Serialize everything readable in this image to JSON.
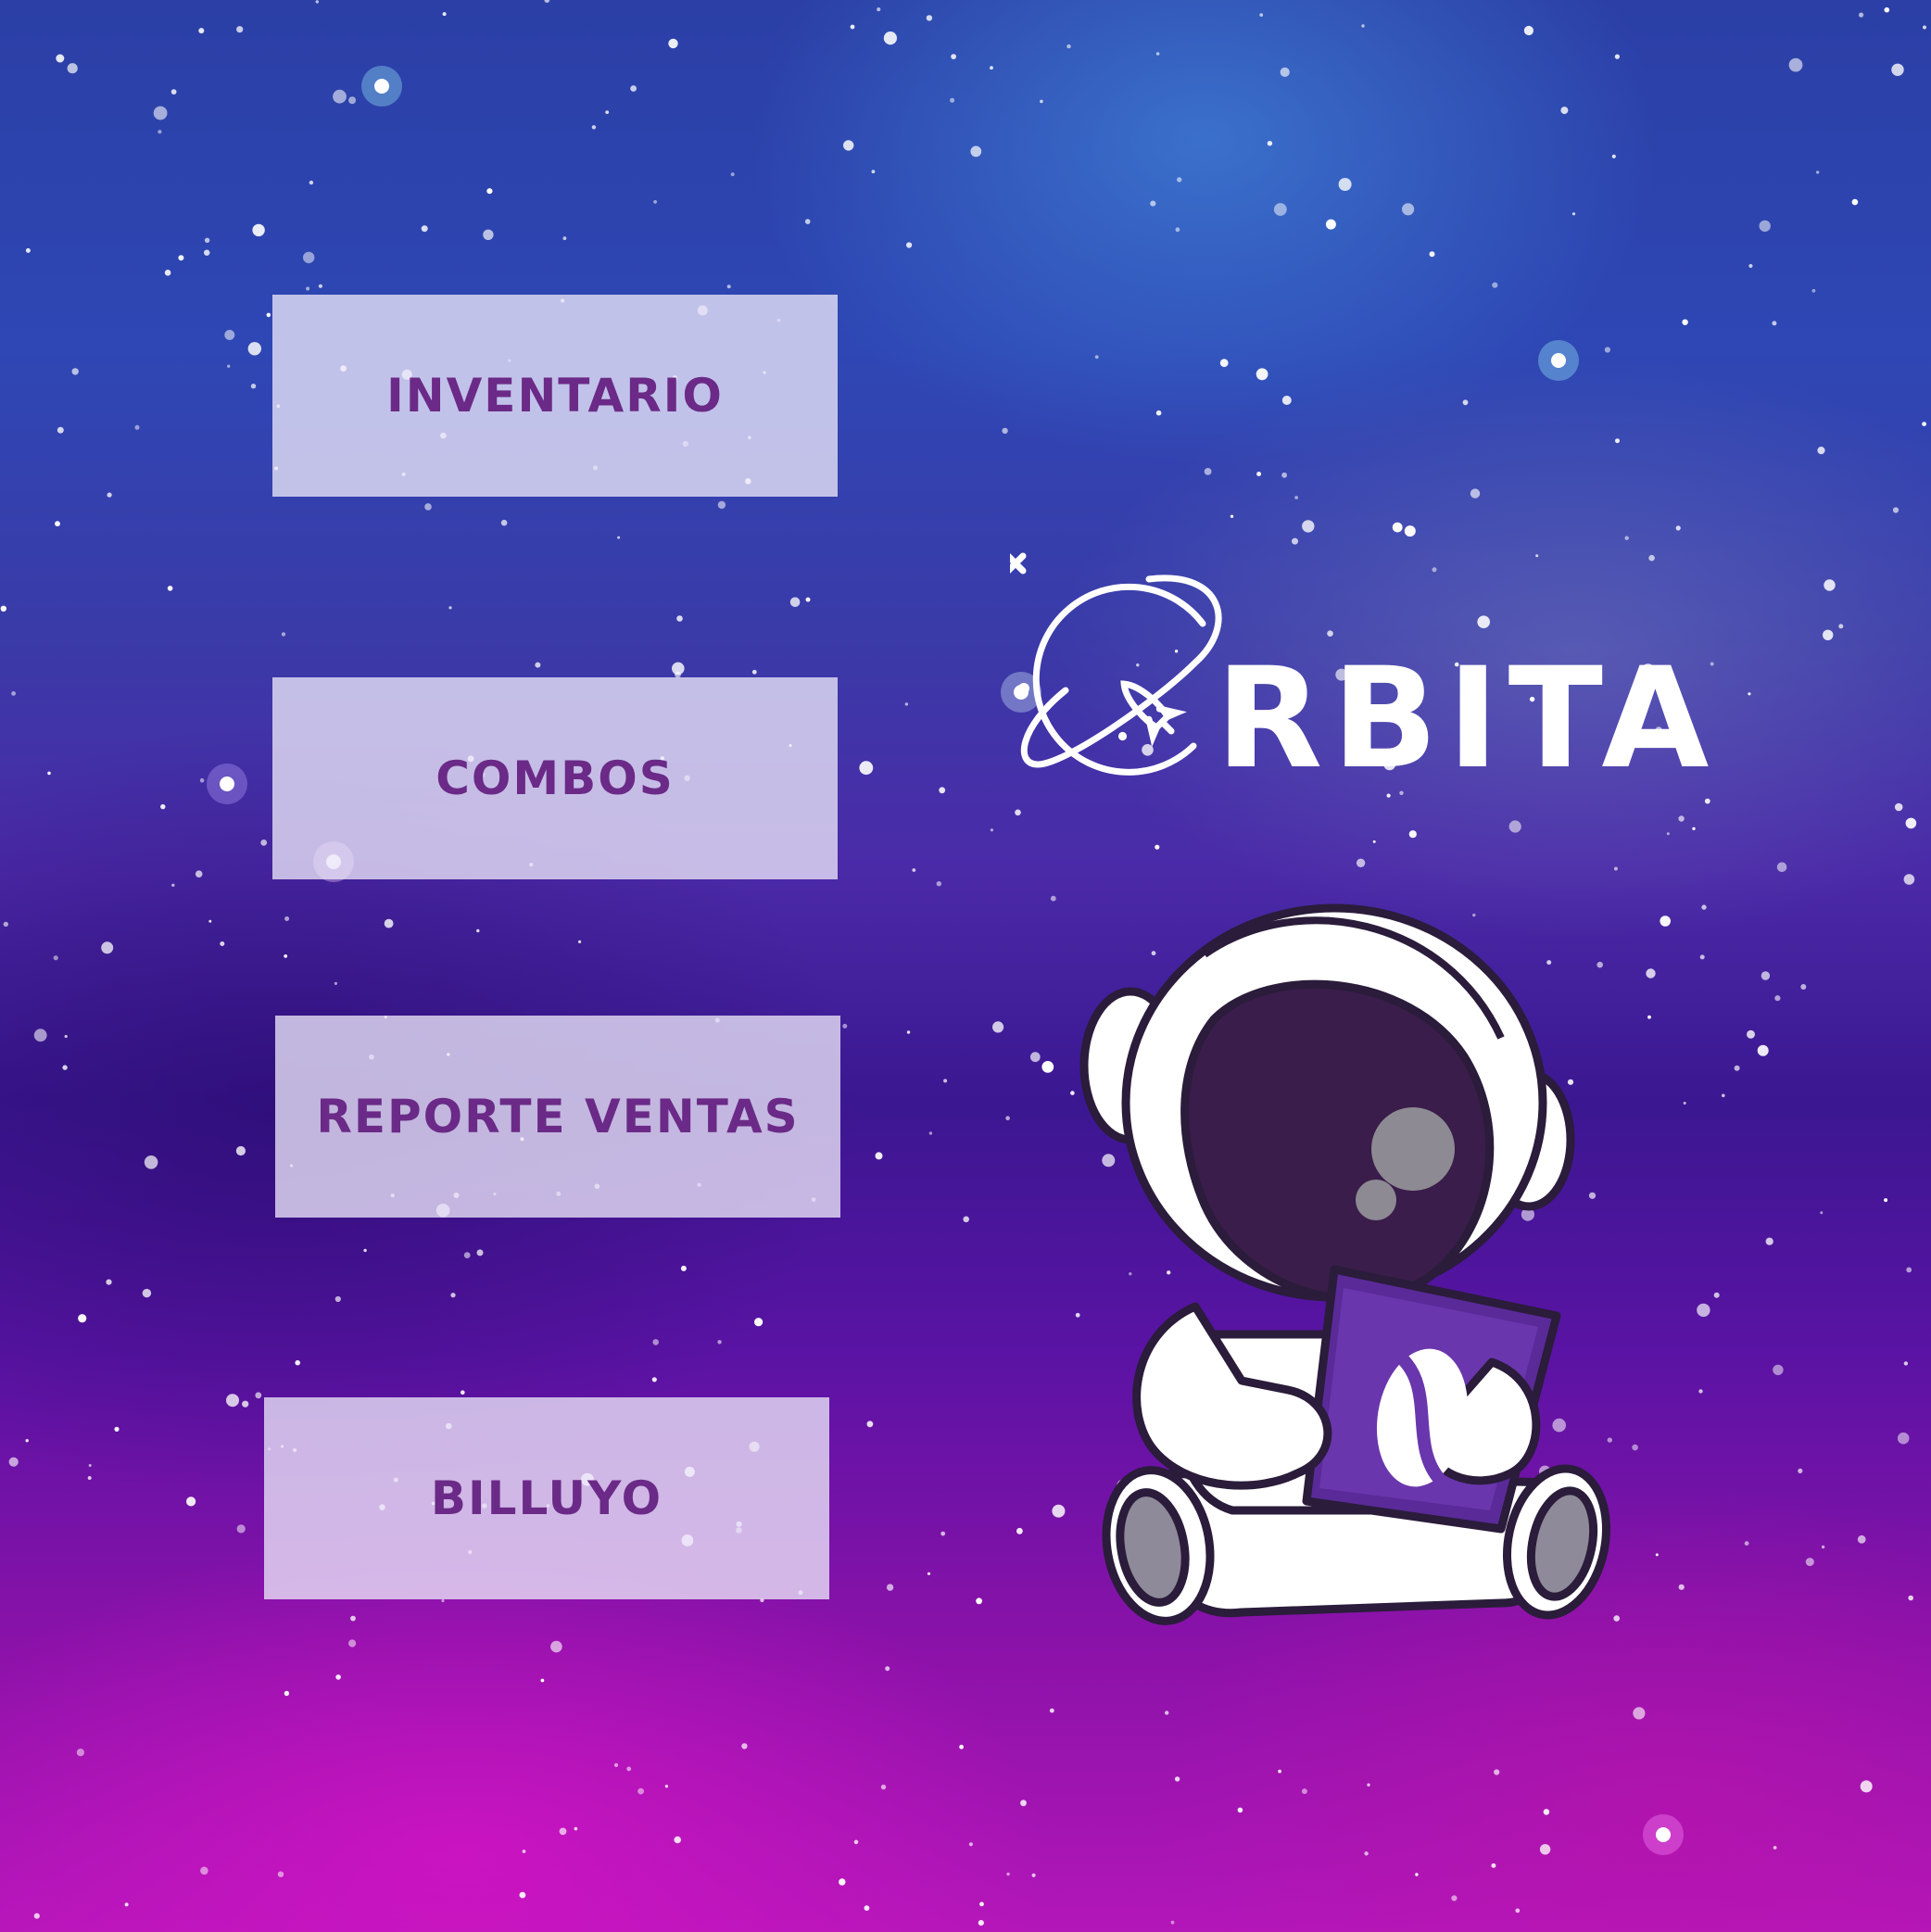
{
  "menu": {
    "items": [
      {
        "label": "INVENTARIO"
      },
      {
        "label": "COMBOS"
      },
      {
        "label": "REPORTE VENTAS"
      },
      {
        "label": "BILLUYO"
      }
    ]
  },
  "logo": {
    "text": "RBITA",
    "icon": "planet-rocket-icon"
  },
  "illustration": {
    "icon": "astronaut-icon"
  },
  "colors": {
    "button_text": "#6b2a87",
    "button_bg": "#ebe6f8",
    "logo_text": "#ffffff"
  }
}
